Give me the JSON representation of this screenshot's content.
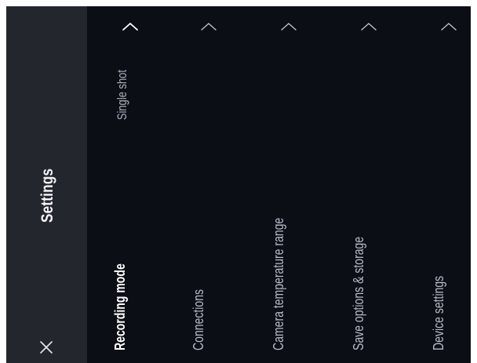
{
  "header": {
    "title": "Settings",
    "close_icon": "close-icon"
  },
  "menu": {
    "items": [
      {
        "label": "Recording mode",
        "value": "Single shot",
        "active": true,
        "icon": "chevron-up-icon"
      },
      {
        "label": "Connections",
        "active": false,
        "icon": "chevron-up-icon"
      },
      {
        "label": "Camera temperature range",
        "active": false,
        "icon": "chevron-up-icon"
      },
      {
        "label": "Save options & storage",
        "active": false,
        "icon": "chevron-up-icon"
      },
      {
        "label": "Device settings",
        "active": false,
        "icon": "chevron-up-icon"
      }
    ]
  },
  "colors": {
    "background": "#0c0e16",
    "sidebar": "#24262e",
    "active_text": "#ffffff",
    "inactive_text": "#b8bbc4"
  }
}
